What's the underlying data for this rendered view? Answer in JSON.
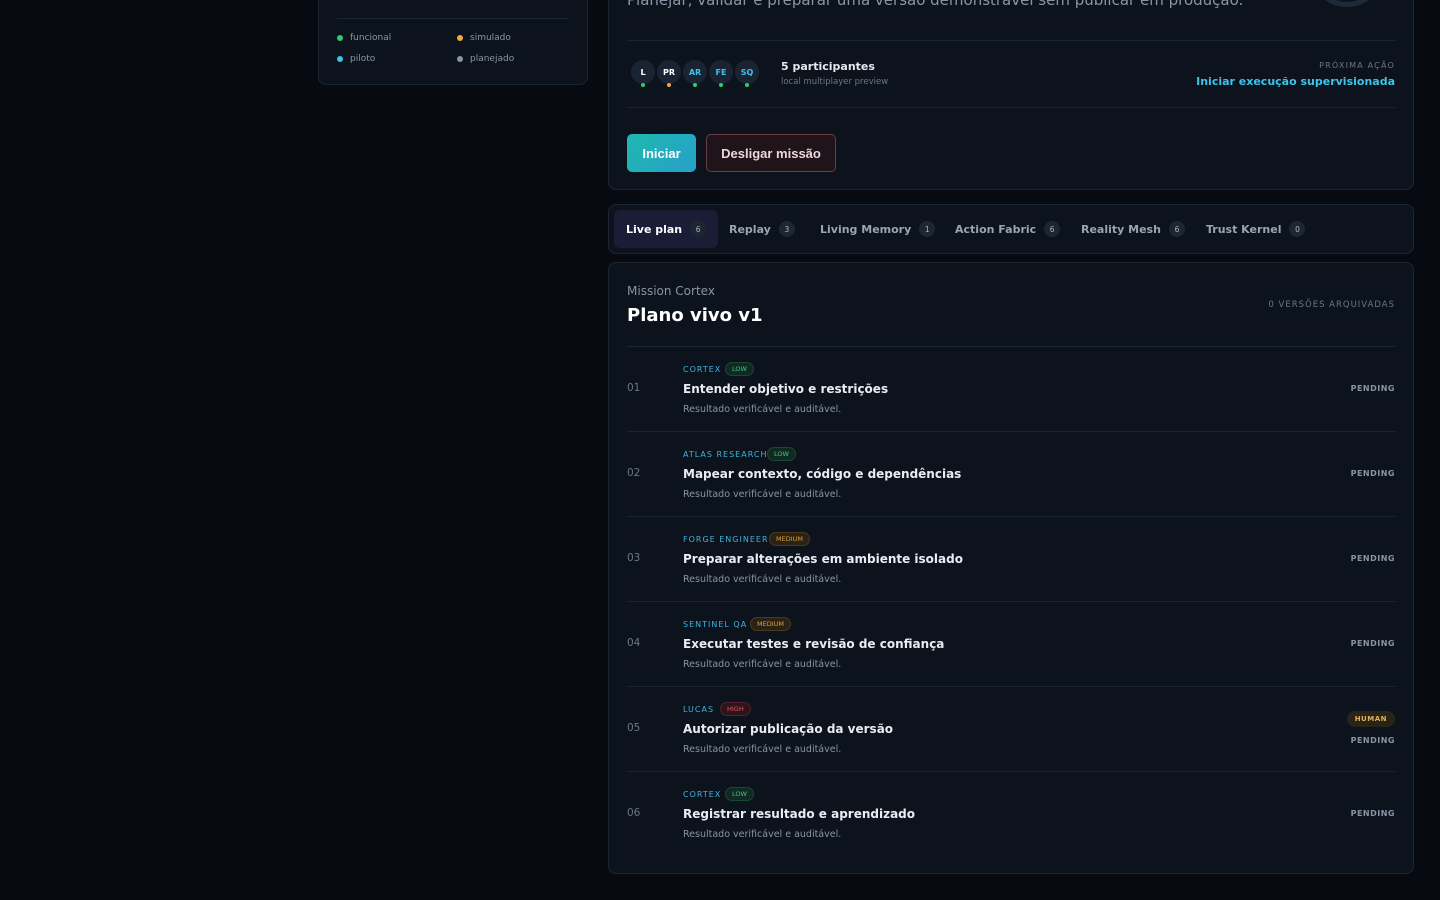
{
  "legend": {
    "items": [
      {
        "label": "funcional",
        "color": "#2ecc71"
      },
      {
        "label": "simulado",
        "color": "#f2a93b"
      },
      {
        "label": "piloto",
        "color": "#3cc4ea"
      },
      {
        "label": "planejado",
        "color": "#8a94a4"
      }
    ]
  },
  "mission": {
    "description": "Planejar, validar e preparar uma versão demonstrável sem publicar em produção.",
    "participants": {
      "title": "5 participantes",
      "subtitle": "local multiplayer preview",
      "avatars": [
        {
          "initials": "L",
          "color": "#ffffff",
          "status": "#2ecc71"
        },
        {
          "initials": "PR",
          "color": "#ffffff",
          "status": "#f2a93b"
        },
        {
          "initials": "AR",
          "color": "#3cc4ea",
          "status": "#2ecc71"
        },
        {
          "initials": "FE",
          "color": "#3cc4ea",
          "status": "#2ecc71"
        },
        {
          "initials": "SQ",
          "color": "#3cc4ea",
          "status": "#2ecc71"
        }
      ]
    },
    "next_label": "PRÓXIMA AÇÃO",
    "next_action": "Iniciar execução supervisionada",
    "start_label": "Iniciar",
    "stop_label": "Desligar missão"
  },
  "tabs": [
    {
      "label": "Live plan",
      "count": "6",
      "active": true
    },
    {
      "label": "Replay",
      "count": "3"
    },
    {
      "label": "Living Memory",
      "count": "1"
    },
    {
      "label": "Action Fabric",
      "count": "6"
    },
    {
      "label": "Reality Mesh",
      "count": "6"
    },
    {
      "label": "Trust Kernel",
      "count": "0"
    }
  ],
  "plan": {
    "kicker": "Mission Cortex",
    "title": "Plano vivo v1",
    "archived": "0 VERSÕES ARQUIVADAS",
    "steps": [
      {
        "num": "01",
        "owner": "CORTEX",
        "risk": "LOW",
        "risk_level": "low",
        "title": "Entender objetivo e restrições",
        "desc": "Resultado verificável e auditável.",
        "status": "PENDING"
      },
      {
        "num": "02",
        "owner": "ATLAS RESEARCH",
        "risk": "LOW",
        "risk_level": "low",
        "title": "Mapear contexto, código e dependências",
        "desc": "Resultado verificável e auditável.",
        "status": "PENDING"
      },
      {
        "num": "03",
        "owner": "FORGE ENGINEER",
        "risk": "MEDIUM",
        "risk_level": "medium",
        "title": "Preparar alterações em ambiente isolado",
        "desc": "Resultado verificável e auditável.",
        "status": "PENDING"
      },
      {
        "num": "04",
        "owner": "SENTINEL QA",
        "risk": "MEDIUM",
        "risk_level": "medium",
        "title": "Executar testes e revisão de confiança",
        "desc": "Resultado verificável e auditável.",
        "status": "PENDING"
      },
      {
        "num": "05",
        "owner": "LUCAS",
        "risk": "HIGH",
        "risk_level": "high",
        "title": "Autorizar publicação da versão",
        "desc": "Resultado verificável e auditável.",
        "status": "PENDING",
        "badge": "HUMAN"
      },
      {
        "num": "06",
        "owner": "CORTEX",
        "risk": "LOW",
        "risk_level": "low",
        "title": "Registrar resultado e aprendizado",
        "desc": "Resultado verificável e auditável.",
        "status": "PENDING"
      }
    ]
  }
}
